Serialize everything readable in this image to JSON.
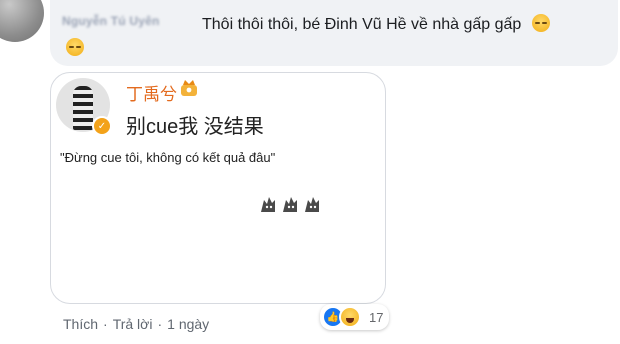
{
  "comment": {
    "author": "Nguyễn Tú Uyên",
    "text": "Thôi thôi thôi, bé Đinh Vũ Hề về nhà gấp gấp",
    "emoji": "sleepy-face-icon"
  },
  "attachment": {
    "name": "丁禹兮",
    "status": "别cue我 没结果",
    "translation": "\"Đừng cue tôi, không có kết quả đâu\""
  },
  "actions": {
    "like": "Thích",
    "reply": "Trả lời",
    "time": "1 ngày"
  },
  "reactions": {
    "types": [
      "like-icon",
      "haha-icon"
    ],
    "count": "17"
  },
  "colors": {
    "bubble": "#f0f2f5",
    "name_orange": "#e36b1f",
    "like_blue": "#1877f2"
  }
}
